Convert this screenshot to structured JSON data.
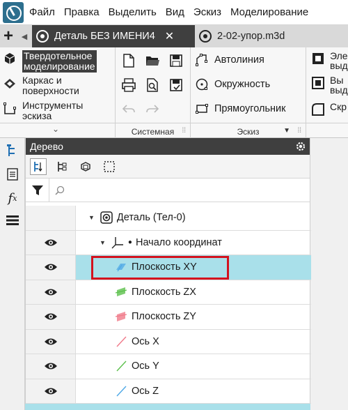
{
  "menubar": {
    "items": [
      "Файл",
      "Правка",
      "Выделить",
      "Вид",
      "Эскиз",
      "Моделирование"
    ]
  },
  "tabs": [
    {
      "label": "Деталь БЕЗ ИМЕНИ4",
      "active": true,
      "close": "✕"
    },
    {
      "label": "2-02-упор.m3d",
      "active": false
    }
  ],
  "ribbon": {
    "modes": [
      {
        "label1": "Твердотельное",
        "label2": "моделирование",
        "icon": "solid-cube-icon",
        "active": true
      },
      {
        "label1": "Каркас и",
        "label2": "поверхности",
        "icon": "surface-icon",
        "active": false
      },
      {
        "label1": "Инструменты",
        "label2": "эскиза",
        "icon": "sketch-tools-icon",
        "active": false
      }
    ],
    "system_group": {
      "label": "Системная"
    },
    "sketch_group": {
      "label": "Эскиз",
      "items": [
        "Автолиния",
        "Окружность",
        "Прямоугольник"
      ]
    },
    "extra_group": {
      "items": [
        {
          "line1": "Эле",
          "line2": "выд"
        },
        {
          "line1": "Вы",
          "line2": "выд"
        },
        {
          "line1": "Скр",
          "line2": ""
        }
      ]
    }
  },
  "tree_panel": {
    "title": "Дерево",
    "search_placeholder": "",
    "rows": [
      {
        "label": "Деталь (Тел-0)",
        "has_eye": false,
        "indent": 1,
        "icon": "part-icon",
        "expanded": true
      },
      {
        "label": "Начало координат",
        "has_eye": true,
        "indent": 2,
        "icon": "origin-icon",
        "expanded": true
      },
      {
        "label": "Плоскость XY",
        "has_eye": true,
        "indent": 3,
        "icon": "plane-xy-icon",
        "selected": true
      },
      {
        "label": "Плоскость ZX",
        "has_eye": true,
        "indent": 3,
        "icon": "plane-zx-icon"
      },
      {
        "label": "Плоскость ZY",
        "has_eye": true,
        "indent": 3,
        "icon": "plane-zy-icon"
      },
      {
        "label": "Ось X",
        "has_eye": true,
        "indent": 3,
        "icon": "axis-x-icon"
      },
      {
        "label": "Ось Y",
        "has_eye": true,
        "indent": 3,
        "icon": "axis-y-icon"
      },
      {
        "label": "Ось Z",
        "has_eye": true,
        "indent": 3,
        "icon": "axis-z-icon"
      }
    ]
  },
  "colors": {
    "selection": "#a9e0ea",
    "highlight_box": "#d3121e",
    "dark_header": "#3f3f3f",
    "plane_xy": "#4ea8e6",
    "plane_zx": "#5cc04c",
    "plane_zy": "#f07a8a"
  }
}
